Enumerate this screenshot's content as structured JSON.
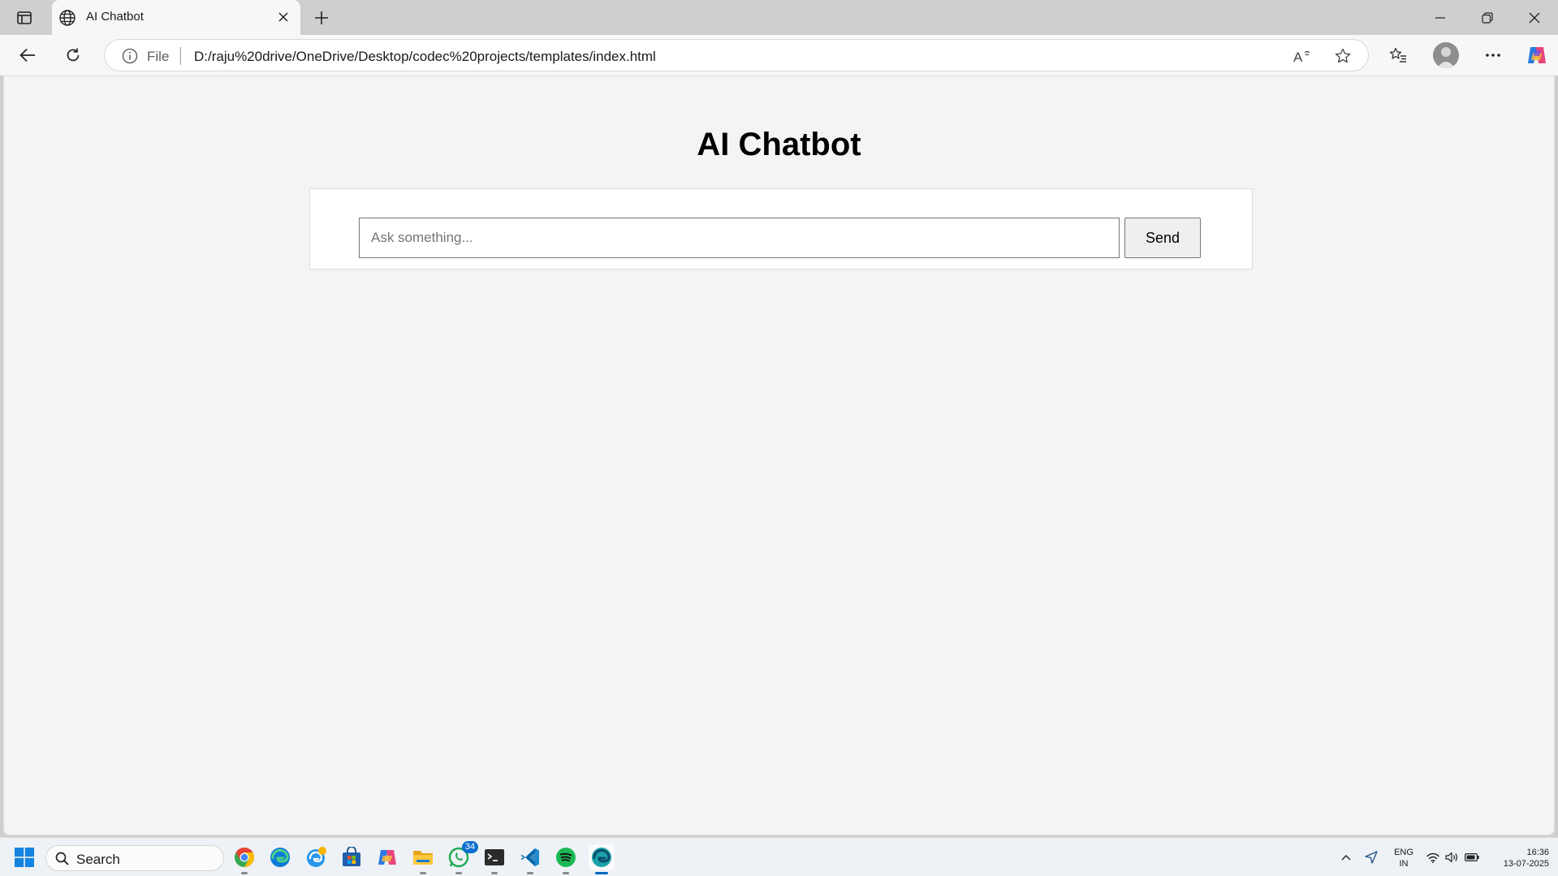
{
  "browser": {
    "tab": {
      "title": "AI Chatbot",
      "favicon": "globe-icon"
    },
    "address": {
      "scheme": "File",
      "url": "D:/raju%20drive/OneDrive/Desktop/codec%20projects/templates/index.html"
    },
    "read_aloud_label": "A"
  },
  "page": {
    "title": "AI Chatbot",
    "input_value": "",
    "input_placeholder": "Ask something...",
    "send_label": "Send"
  },
  "taskbar": {
    "search_label": "Search",
    "apps": [
      "chrome",
      "edge",
      "edge-beta",
      "microsoft-store",
      "copilot",
      "file-explorer",
      "whatsapp",
      "terminal",
      "vscode",
      "spotify",
      "edge-dev"
    ],
    "whatsapp_badge": "34",
    "language": "ENG",
    "region": "IN",
    "time": "16:36",
    "date": "13-07-2025"
  },
  "colors": {
    "accent": "#0067c0",
    "page_bg": "#f4f4f4",
    "taskbar_bg": "#eef1f5"
  }
}
